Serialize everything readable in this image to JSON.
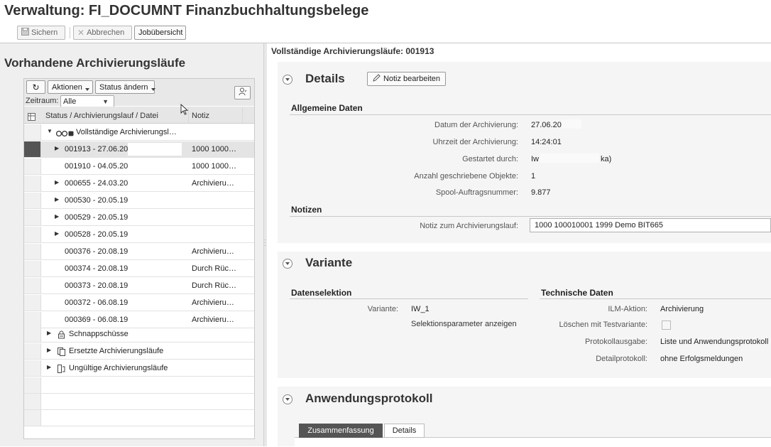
{
  "header": {
    "title": "Verwaltung: FI_DOCUMNT Finanzbuchhaltungsbelege",
    "buttons": {
      "save": "Sichern",
      "cancel": "Abbrechen",
      "jobs": "Jobübersicht"
    }
  },
  "left": {
    "title": "Vorhandene Archivierungsläufe",
    "toolbar": {
      "actions": "Aktionen",
      "status_change": "Status ändern"
    },
    "zeitraum": {
      "label": "Zeitraum:",
      "value": "Alle"
    },
    "columns": {
      "status": "Status / Archivierungslauf / Datei",
      "note": "Notiz"
    },
    "tree": {
      "group_complete": "Vollständige Archivierungsl…",
      "rows": [
        {
          "label": "001913 - 27.06.20",
          "note": "1000 1000…"
        },
        {
          "label": "001910 - 04.05.20",
          "note": "1000 1000…"
        },
        {
          "label": "000655 - 24.03.20",
          "note": "Archivieru…"
        },
        {
          "label": "000530 - 20.05.19",
          "note": ""
        },
        {
          "label": "000529 - 20.05.19",
          "note": ""
        },
        {
          "label": "000528 - 20.05.19",
          "note": ""
        },
        {
          "label": "000376 - 20.08.19",
          "note": "Archivieru…"
        },
        {
          "label": "000374 - 20.08.19",
          "note": "Durch Rüc…"
        },
        {
          "label": "000373 - 20.08.19",
          "note": "Durch Rüc…"
        },
        {
          "label": "000372 - 06.08.19",
          "note": "Archivieru…"
        },
        {
          "label": "000369 - 06.08.19",
          "note": "Archivieru…"
        }
      ],
      "snapshots": "Schnappschüsse",
      "replaced": "Ersetzte Archivierungsläufe",
      "invalid": "Ungültige Archivierungsläufe"
    }
  },
  "right": {
    "title": "Vollständige Archivierungsläufe: 001913",
    "details": {
      "heading": "Details",
      "note_button": "Notiz bearbeiten",
      "general": {
        "heading": "Allgemeine Daten",
        "date_label": "Datum der Archivierung:",
        "date_value": "27.06.20",
        "time_label": "Uhrzeit der Archivierung:",
        "time_value": "14:24:01",
        "started_label": "Gestartet durch:",
        "started_value_a": "Iw",
        "started_value_b": "ka)",
        "objects_label": "Anzahl geschriebene Objekte:",
        "objects_value": "1",
        "spool_label": "Spool-Auftragsnummer:",
        "spool_value": "9.877"
      },
      "notes": {
        "heading": "Notizen",
        "label": "Notiz zum Archivierungslauf:",
        "value": "1000 100010001 1999 Demo BIT665"
      }
    },
    "variant": {
      "heading": "Variante",
      "selection": {
        "heading": "Datenselektion",
        "variant_label": "Variante:",
        "variant_value": "IW_1",
        "show_params": "Selektionsparameter anzeigen"
      },
      "technical": {
        "heading": "Technische Daten",
        "ilm_label": "ILM-Aktion:",
        "ilm_value": "Archivierung",
        "test_label": "Löschen mit Testvariante:",
        "log_label": "Protokollausgabe:",
        "log_value": "Liste und Anwendungsprotokoll",
        "detail_label": "Detailprotokoll:",
        "detail_value": "ohne Erfolgsmeldungen"
      }
    },
    "app_log": {
      "heading": "Anwendungsprotokoll",
      "tab_summary": "Zusammenfassung",
      "tab_details": "Details"
    }
  }
}
